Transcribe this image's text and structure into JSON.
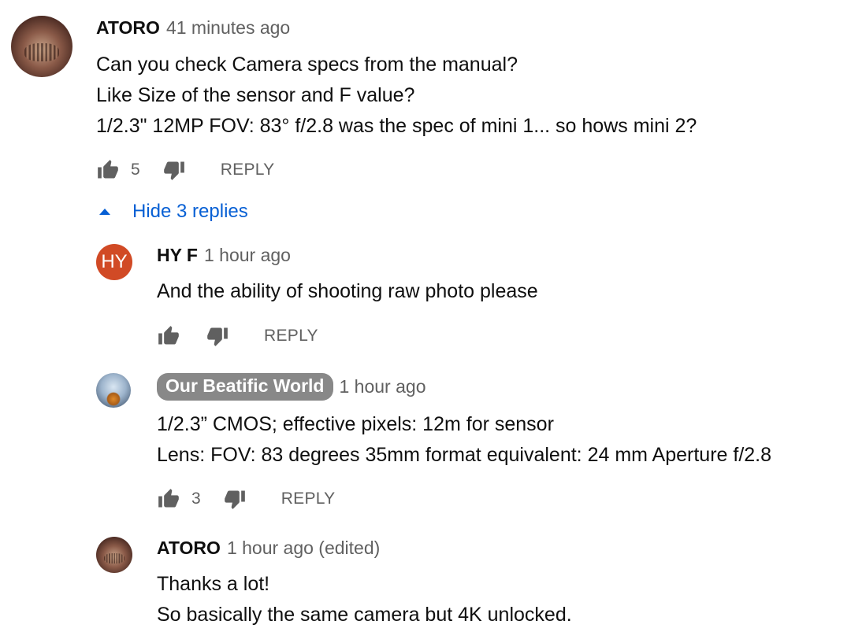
{
  "comment": {
    "author": "ATORO",
    "time": "41 minutes ago",
    "lines": [
      "Can you check Camera specs from the manual?",
      "Like Size of the sensor and F value?",
      "1/2.3\" 12MP FOV: 83° f/2.8 was the spec of mini 1... so hows mini 2?"
    ],
    "likes": "5",
    "reply_label": "REPLY"
  },
  "toggle_replies_label": "Hide 3 replies",
  "replies": [
    {
      "avatar_text": "HY",
      "author": "HY F",
      "time": "1 hour ago",
      "lines": [
        "And the ability of shooting raw photo please"
      ],
      "likes": "",
      "reply_label": "REPLY"
    },
    {
      "author": "Our Beatific World",
      "time": "1 hour ago",
      "lines": [
        "1/2.3” CMOS; effective pixels: 12m for sensor",
        "Lens: FOV: 83 degrees 35mm format equivalent: 24 mm Aperture f/2.8"
      ],
      "likes": "3",
      "reply_label": "REPLY"
    },
    {
      "author": "ATORO",
      "time": "1 hour ago (edited)",
      "lines": [
        "Thanks a lot!",
        "So basically the same camera but 4K unlocked."
      ]
    }
  ],
  "icons": {
    "like": "thumbs-up-icon",
    "dislike": "thumbs-down-icon",
    "toggle": "caret-up-icon"
  },
  "colors": {
    "link": "#065fd4",
    "meta_text": "#606060",
    "owner_pill": "#888888",
    "hy_avatar": "#d14a25"
  }
}
